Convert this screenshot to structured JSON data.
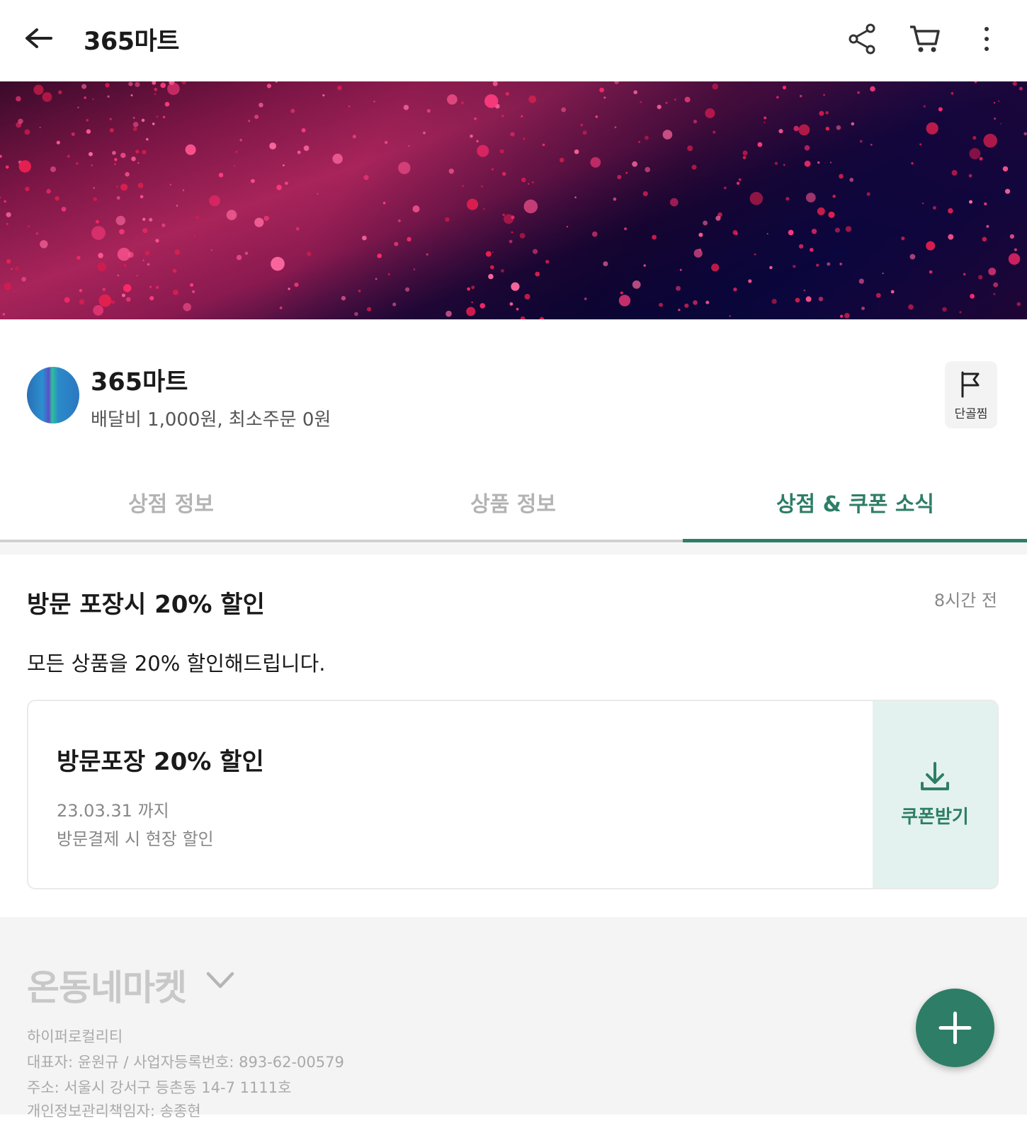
{
  "appbar": {
    "title": "365마트",
    "icons": [
      "back-arrow-icon",
      "share-icon",
      "cart-icon",
      "more-vert-icon"
    ]
  },
  "store": {
    "name": "365마트",
    "subtitle": "배달비 1,000원, 최소주문 0원",
    "favorite_label": "단골찜"
  },
  "tabs": [
    {
      "label": "상점 정보",
      "active": false
    },
    {
      "label": "상품 정보",
      "active": false
    },
    {
      "label": "상점 & 쿠폰 소식",
      "active": true
    }
  ],
  "post": {
    "title": "방문 포장시 20% 할인",
    "time": "8시간 전",
    "body": "모든 상품을 20% 할인해드립니다."
  },
  "coupon": {
    "title": "방문포장 20% 할인",
    "valid_until": "23.03.31 까지",
    "description": "방문결제 시 현장 할인",
    "action_label": "쿠폰받기"
  },
  "footer": {
    "brand": "온동네마켓",
    "lines": [
      "하이퍼로컬리티",
      "대표자: 윤원규 / 사업자등록번호: 893-62-00579",
      "주소: 서울시 강서구 등촌동 14-7 1111호",
      "개인정보관리책임자: 송종현"
    ]
  },
  "colors": {
    "accent": "#2e7d67",
    "coupon_bg": "#e3f2ef",
    "footer_bg": "#f4f4f4"
  }
}
